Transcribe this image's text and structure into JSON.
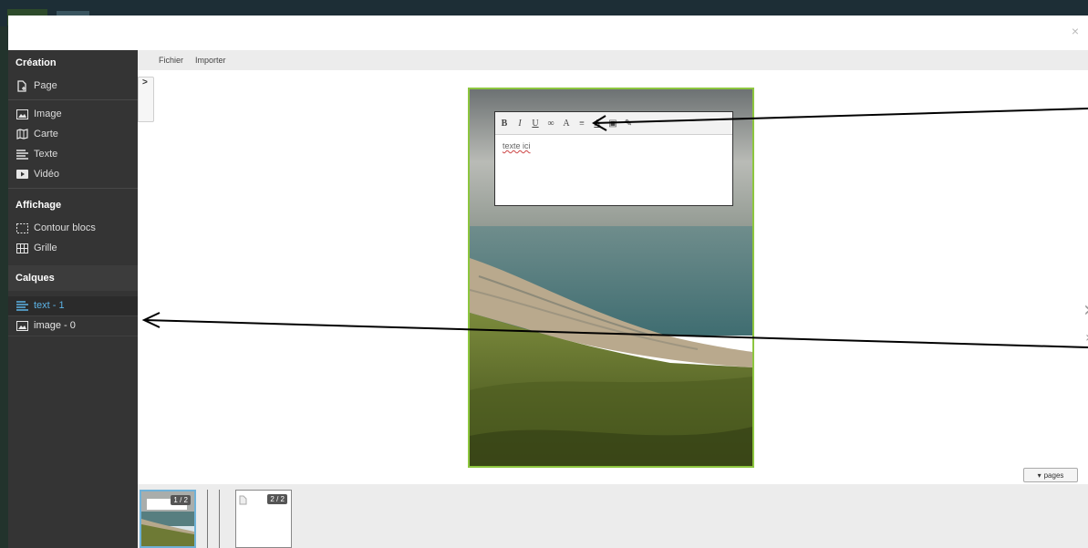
{
  "modal": {
    "close_label": "×"
  },
  "sidebar": {
    "creation_title": "Création",
    "creation_items": [
      {
        "label": "Page",
        "icon": "new-page-icon"
      },
      {
        "label": "Image",
        "icon": "image-icon"
      },
      {
        "label": "Carte",
        "icon": "map-icon"
      },
      {
        "label": "Texte",
        "icon": "text-lines-icon"
      },
      {
        "label": "Vidéo",
        "icon": "video-icon"
      }
    ],
    "display_title": "Affichage",
    "display_items": [
      {
        "label": "Contour blocs",
        "icon": "dashed-outline-icon"
      },
      {
        "label": "Grille",
        "icon": "grid-icon"
      }
    ],
    "layers_title": "Calques",
    "layers": [
      {
        "label": "text - 1",
        "icon": "text-lines-icon",
        "active": true
      },
      {
        "label": "image - 0",
        "icon": "image-icon",
        "active": false
      }
    ]
  },
  "menubar": {
    "file": "Fichier",
    "import": "Importer"
  },
  "editor": {
    "toolbar": [
      "B",
      "I",
      "U",
      "∞",
      "A",
      "≡",
      "A",
      "▣",
      "✎"
    ],
    "body_text": "texte ici"
  },
  "navigation": {
    "next": "›",
    "last": "»",
    "pages_button": "pages"
  },
  "thumbnails": [
    {
      "label": "1 / 2"
    },
    {
      "label": "2 / 2"
    }
  ],
  "colors": {
    "accent_blue": "#5cb3e6",
    "page_border_green": "#8dc63f",
    "sidebar_bg": "#343434"
  }
}
